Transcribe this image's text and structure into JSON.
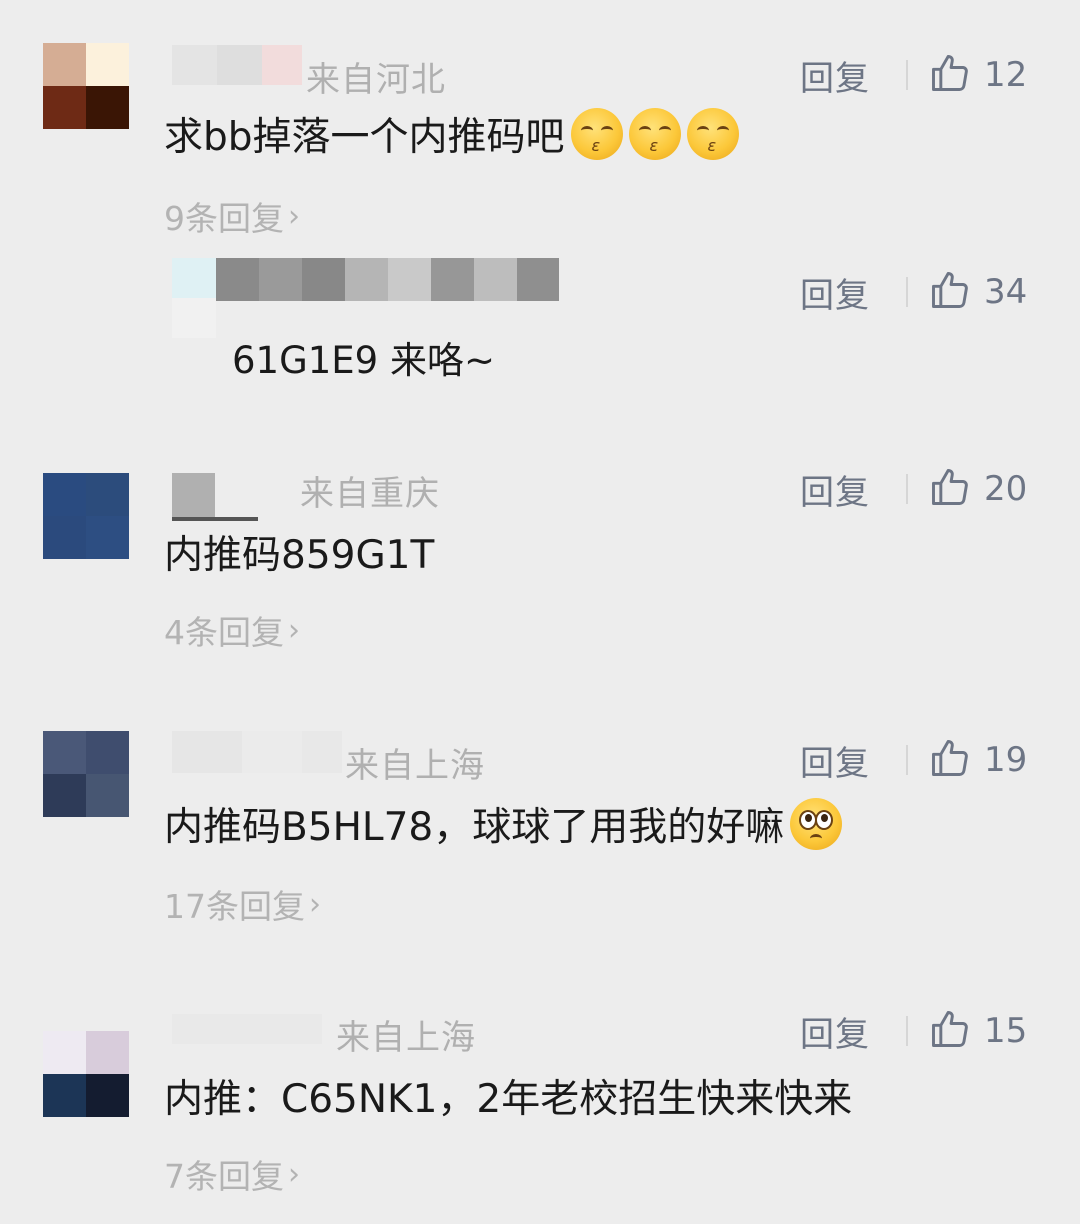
{
  "comments": [
    {
      "location": "来自河北",
      "reply_label": "回复",
      "likes": "12",
      "text": "求bb掉落一个内推码吧",
      "emojis": [
        "kissing-face-icon",
        "kissing-face-icon",
        "kissing-face-icon"
      ],
      "more_replies": "9条回复",
      "sub_reply": {
        "reply_label": "回复",
        "likes": "34",
        "text": "61G1E9 来咯~"
      }
    },
    {
      "location": "来自重庆",
      "reply_label": "回复",
      "likes": "20",
      "text": "内推码859G1T",
      "more_replies": "4条回复"
    },
    {
      "location": "来自上海",
      "reply_label": "回复",
      "likes": "19",
      "text": "内推码B5HL78，球球了用我的好嘛",
      "emojis": [
        "pleading-face-icon"
      ],
      "more_replies": "17条回复"
    },
    {
      "location": "来自上海",
      "reply_label": "回复",
      "likes": "15",
      "text": "内推：C65NK1，2年老校招生快来快来",
      "more_replies": "7条回复"
    }
  ],
  "colors": {
    "background": "#ededed",
    "action_text": "#6d7585",
    "muted_text": "#b3b3b3",
    "content_text": "#1a1a1a"
  }
}
